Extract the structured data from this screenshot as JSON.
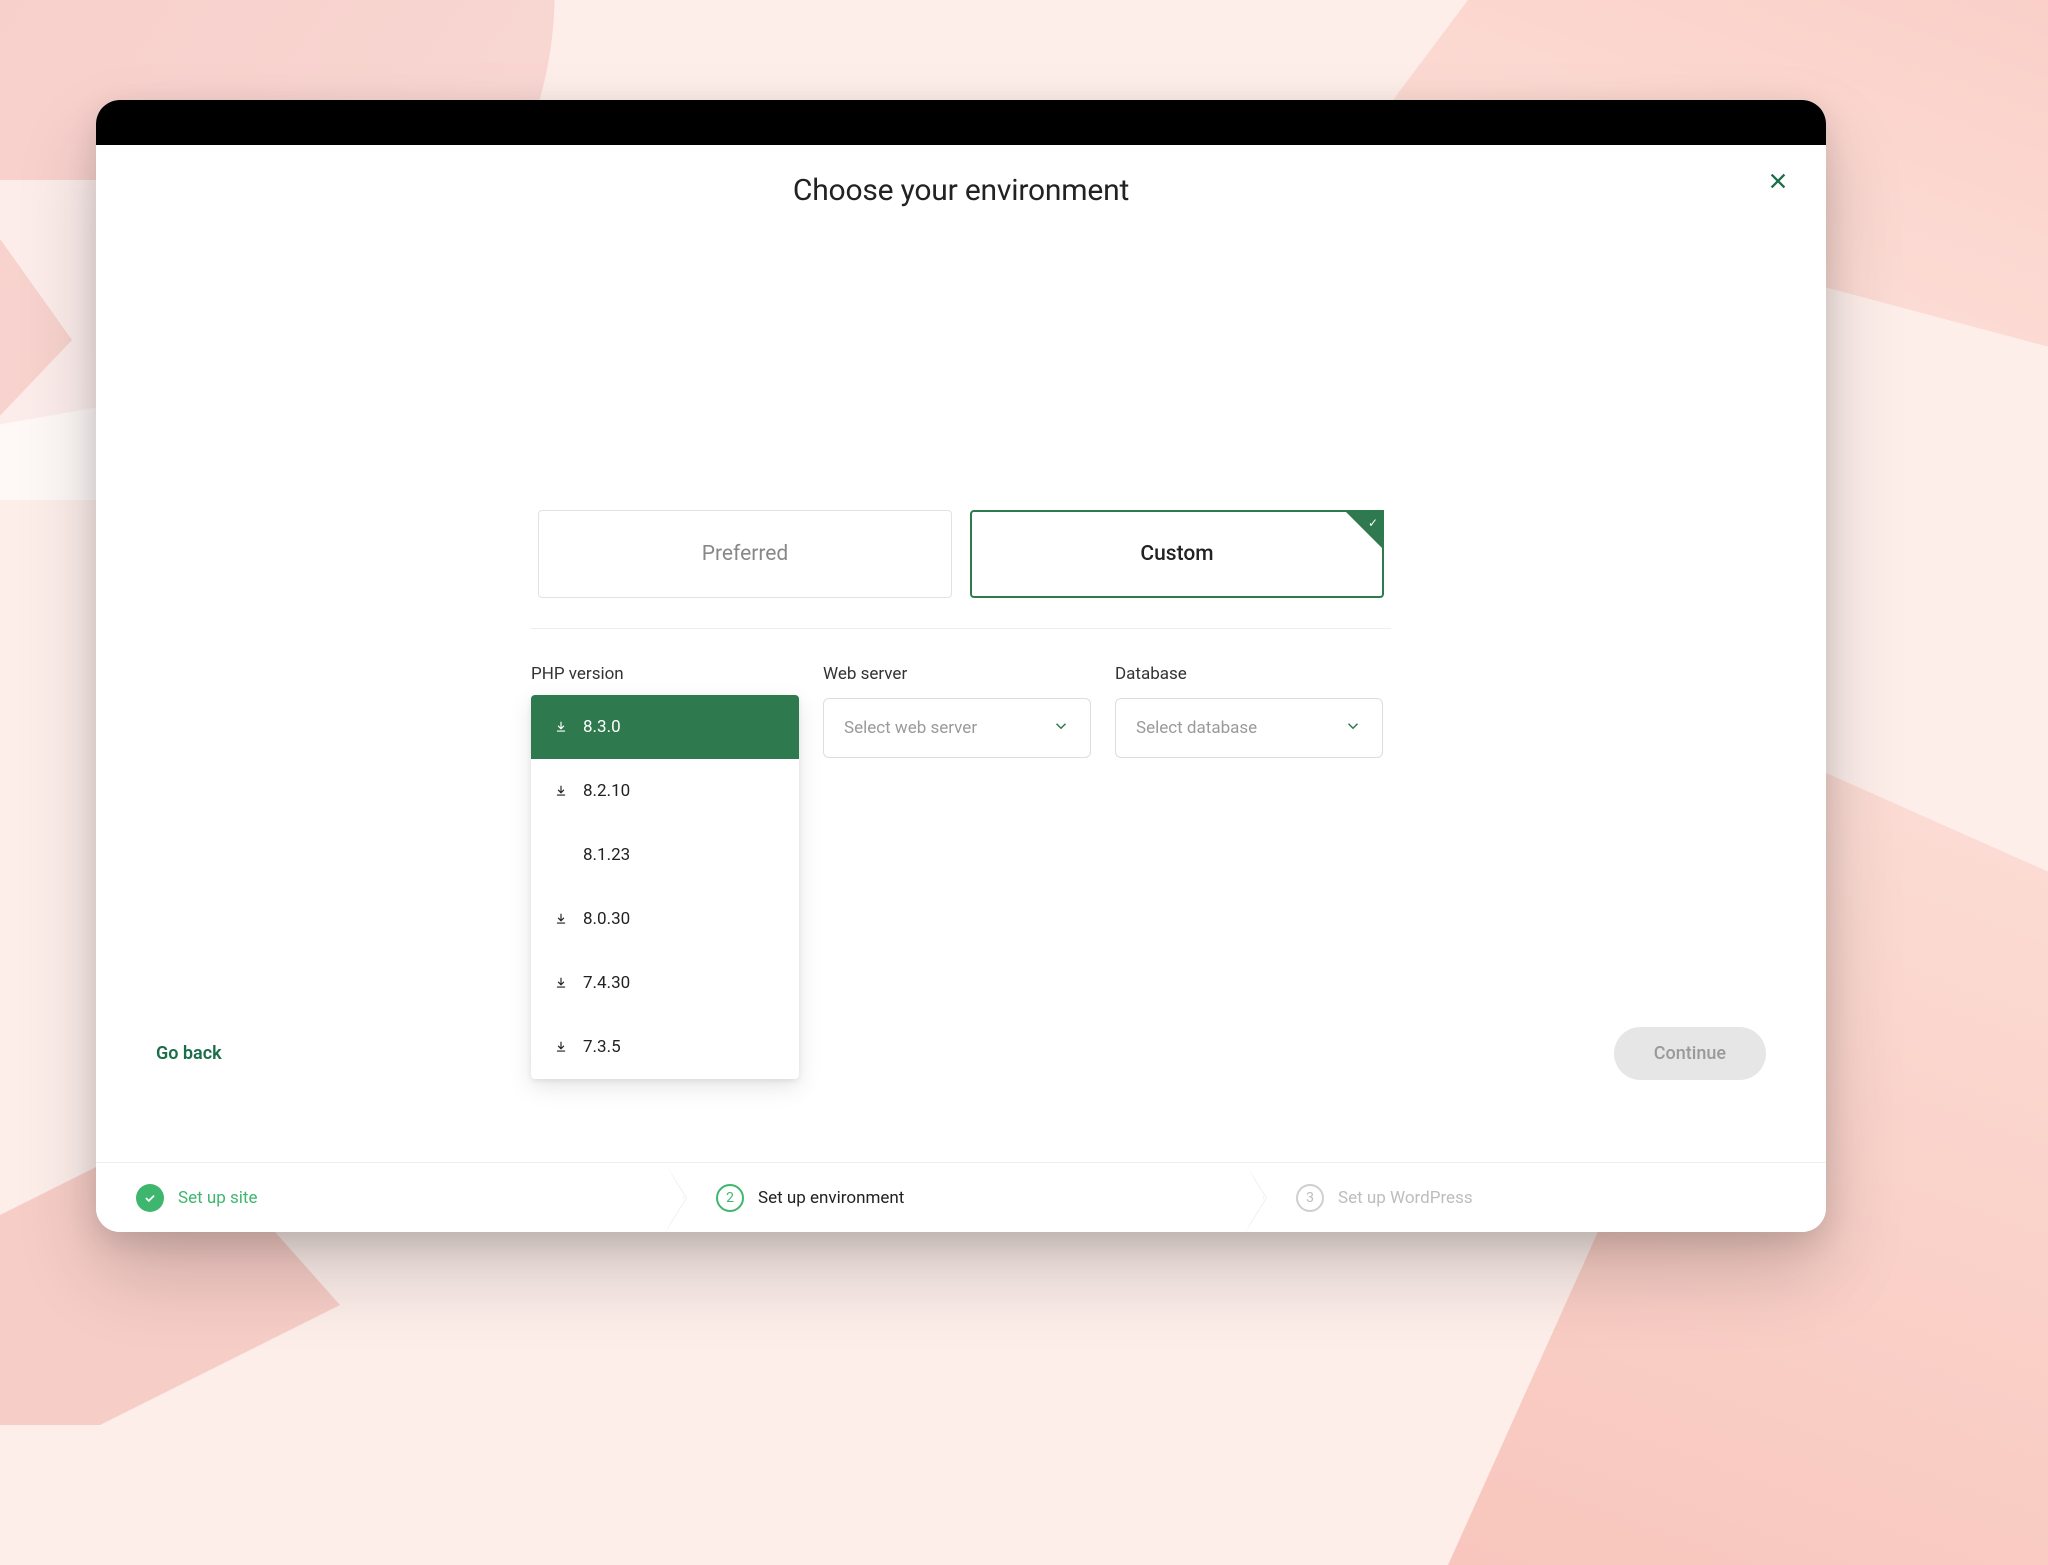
{
  "header": {
    "title": "Choose your environment"
  },
  "tabs": {
    "preferred": "Preferred",
    "custom": "Custom"
  },
  "form": {
    "php_label": "PHP version",
    "webserver_label": "Web server",
    "webserver_placeholder": "Select web server",
    "database_label": "Database",
    "database_placeholder": "Select database",
    "php_options": [
      {
        "version": "8.3.0",
        "downloadable": true,
        "selected": true
      },
      {
        "version": "8.2.10",
        "downloadable": true,
        "selected": false
      },
      {
        "version": "8.1.23",
        "downloadable": false,
        "selected": false
      },
      {
        "version": "8.0.30",
        "downloadable": true,
        "selected": false
      },
      {
        "version": "7.4.30",
        "downloadable": true,
        "selected": false
      },
      {
        "version": "7.3.5",
        "downloadable": true,
        "selected": false
      }
    ]
  },
  "footer": {
    "go_back": "Go back",
    "continue": "Continue"
  },
  "stepper": {
    "steps": [
      {
        "label": "Set up site",
        "status": "done",
        "indicator": "check"
      },
      {
        "label": "Set up environment",
        "status": "active",
        "indicator": "2"
      },
      {
        "label": "Set up WordPress",
        "status": "pending",
        "indicator": "3"
      }
    ]
  },
  "colors": {
    "accent": "#2e7a4e",
    "accent_light": "#3fb66d"
  }
}
